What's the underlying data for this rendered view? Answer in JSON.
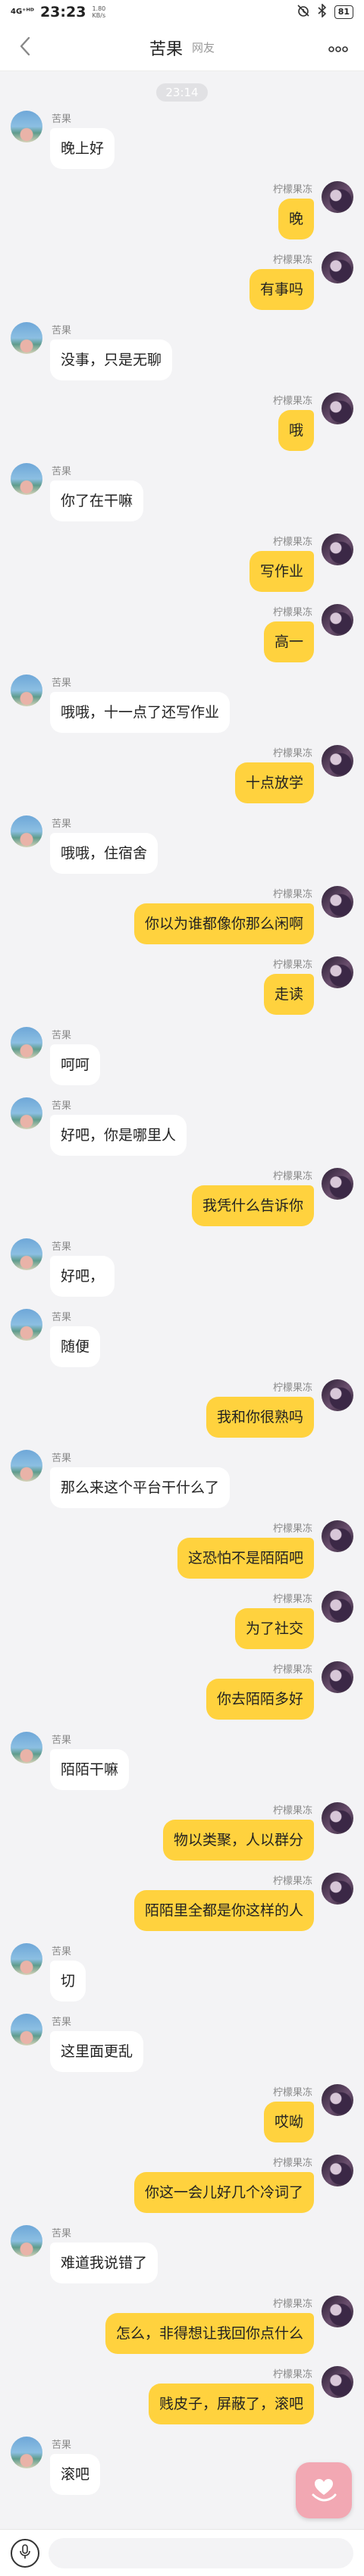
{
  "status_bar": {
    "signal": "4G⁺ᴴᴰ",
    "time": "23:23",
    "net_speed_value": "1.80",
    "net_speed_unit": "KB/s",
    "battery": "81"
  },
  "header": {
    "title": "苦果",
    "subtitle": "网友"
  },
  "chat": {
    "timestamp": "23:14",
    "contact_name": "苦果",
    "my_name": "柠檬果冻",
    "messages": [
      {
        "side": "left",
        "text": "晚上好"
      },
      {
        "side": "right",
        "text": "晚"
      },
      {
        "side": "right",
        "text": "有事吗"
      },
      {
        "side": "left",
        "text": "没事，只是无聊"
      },
      {
        "side": "right",
        "text": "哦"
      },
      {
        "side": "left",
        "text": "你了在干嘛"
      },
      {
        "side": "right",
        "text": "写作业"
      },
      {
        "side": "right",
        "text": "高一"
      },
      {
        "side": "left",
        "text": "哦哦，十一点了还写作业"
      },
      {
        "side": "right",
        "text": "十点放学"
      },
      {
        "side": "left",
        "text": "哦哦，住宿舍"
      },
      {
        "side": "right",
        "text": "你以为谁都像你那么闲啊"
      },
      {
        "side": "right",
        "text": "走读"
      },
      {
        "side": "left",
        "text": "呵呵"
      },
      {
        "side": "left",
        "text": "好吧，你是哪里人"
      },
      {
        "side": "right",
        "text": "我凭什么告诉你"
      },
      {
        "side": "left",
        "text": "好吧，"
      },
      {
        "side": "left",
        "text": "随便"
      },
      {
        "side": "right",
        "text": "我和你很熟吗"
      },
      {
        "side": "left",
        "text": "那么来这个平台干什么了"
      },
      {
        "side": "right",
        "text": "这恐怕不是陌陌吧"
      },
      {
        "side": "right",
        "text": "为了社交"
      },
      {
        "side": "right",
        "text": "你去陌陌多好"
      },
      {
        "side": "left",
        "text": "陌陌干嘛"
      },
      {
        "side": "right",
        "text": "物以类聚，人以群分"
      },
      {
        "side": "right",
        "text": "陌陌里全都是你这样的人"
      },
      {
        "side": "left",
        "text": "切"
      },
      {
        "side": "left",
        "text": "这里面更乱"
      },
      {
        "side": "right",
        "text": "哎呦"
      },
      {
        "side": "right",
        "text": "你这一会儿好几个冷词了"
      },
      {
        "side": "left",
        "text": "难道我说错了"
      },
      {
        "side": "right",
        "text": "怎么，非得想让我回你点什么"
      },
      {
        "side": "right",
        "text": "贱皮子，屏蔽了，滚吧"
      },
      {
        "side": "left",
        "text": "滚吧"
      }
    ]
  },
  "icons": {
    "back": "chevron-left-icon",
    "more": "more-dots-icon",
    "mic": "microphone-icon",
    "floating": "heart-hand-icon"
  },
  "colors": {
    "my_bubble": "#ffd23e",
    "their_bubble": "#ffffff",
    "background": "#f3f3f5",
    "floating_button": "#f2a8b3"
  }
}
